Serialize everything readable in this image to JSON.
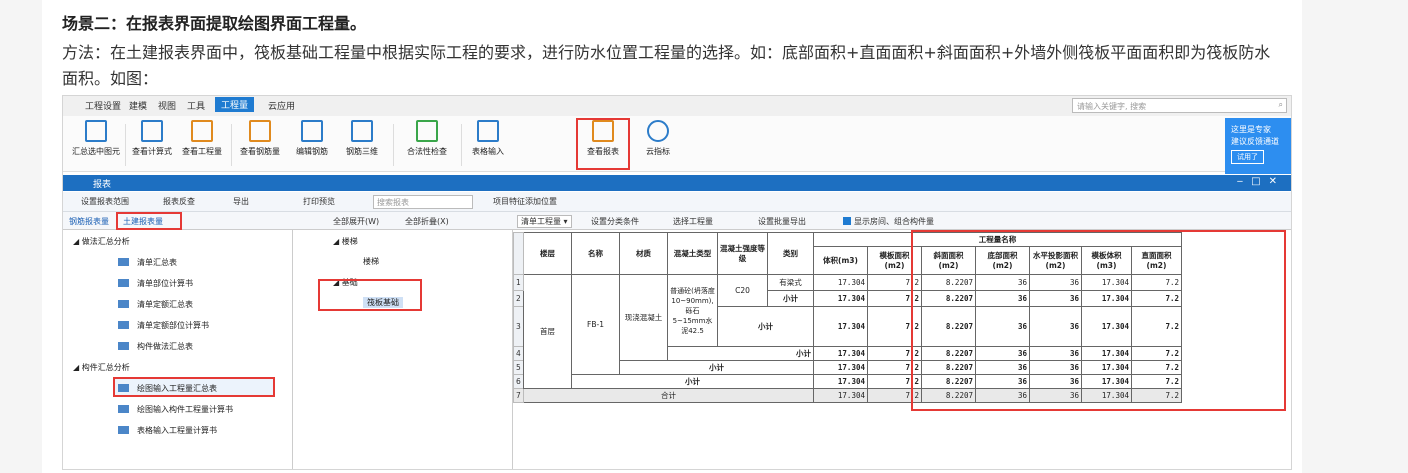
{
  "article": {
    "title": "场景二：在报表界面提取绘图界面工程量。",
    "paragraph": "方法：在土建报表界面中，筏板基础工程量中根据实际工程的要求，进行防水位置工程量的选择。如：底部面积+直面面积+斜面面积+外墙外侧筏板平面面积即为筏板防水面积。如图："
  },
  "menubar": {
    "items": [
      "工程设置",
      "建模",
      "视图",
      "工具",
      "工程量",
      "云应用"
    ],
    "active": "工程量",
    "search_placeholder": "请输入关键字, 搜索"
  },
  "ribbon": {
    "buttons": [
      "汇总选中图元",
      "查看计算式",
      "查看工程量",
      "查看钢筋量",
      "编辑钢筋",
      "钢筋三维",
      "合法性检查",
      "表格输入",
      "查看报表",
      "云指标"
    ],
    "highlighted": "查看报表"
  },
  "promo": {
    "line1": "这里是专家",
    "line2": "建议反馈通道",
    "button": "试用了"
  },
  "dialog": {
    "title": "报表"
  },
  "report_toolbar": {
    "items": [
      "设置报表范围",
      "报表反查",
      "导出",
      "打印预览"
    ],
    "search_placeholder": "搜索报表",
    "extra": "项目特征添加位置"
  },
  "left_panel": {
    "tabs": [
      "钢筋报表量",
      "土建报表量"
    ],
    "active_tab": "土建报表量",
    "groups": [
      {
        "label": "做法汇总分析",
        "items": [
          "清单汇总表",
          "清单部位计算书",
          "清单定额汇总表",
          "清单定额部位计算书",
          "构件做法汇总表"
        ]
      },
      {
        "label": "构件汇总分析",
        "items": [
          "绘图输入工程量汇总表",
          "绘图输入构件工程量计算书",
          "表格输入工程量计算书"
        ]
      }
    ],
    "selected_item": "绘图输入工程量汇总表"
  },
  "mid_panel": {
    "expand_all": "全部展开(W)",
    "collapse_all": "全部折叠(X)",
    "tree": [
      {
        "label": "楼梯",
        "child": "楼梯"
      },
      {
        "label": "基础",
        "child": "筏板基础"
      }
    ]
  },
  "right_toolbar": {
    "dropdown": "清单工程量",
    "items": [
      "设置分类条件",
      "选择工程量",
      "设置批量导出",
      "显示房间、组合构件量"
    ]
  },
  "table": {
    "headers": {
      "floor": "楼层",
      "name": "名称",
      "material": "材质",
      "concrete_type": "混凝土类型",
      "grade": "混凝土强度等级",
      "category": "类别",
      "group": "工程量名称"
    },
    "columns": [
      "体积(m3)",
      "模板面积(m2)",
      "斜面面积(m2)",
      "底部面积(m2)",
      "水平投影面积(m2)",
      "模板体积(m3)",
      "直面面积(m2)"
    ],
    "floor": "首层",
    "name": "FB-1",
    "material": "现浇混凝土",
    "concrete_type": "普通砼(坍落度10~90mm),砾石5~15mm水泥42.5",
    "grade": "C20",
    "cat1": "有梁式",
    "subtotal": "小计",
    "total": "合计",
    "row_numbers": [
      "1",
      "2",
      "3",
      "4",
      "5",
      "6",
      "7"
    ],
    "values": [
      "17.304",
      "7.2",
      "8.2207",
      "36",
      "36",
      "17.304",
      "7.2"
    ]
  }
}
